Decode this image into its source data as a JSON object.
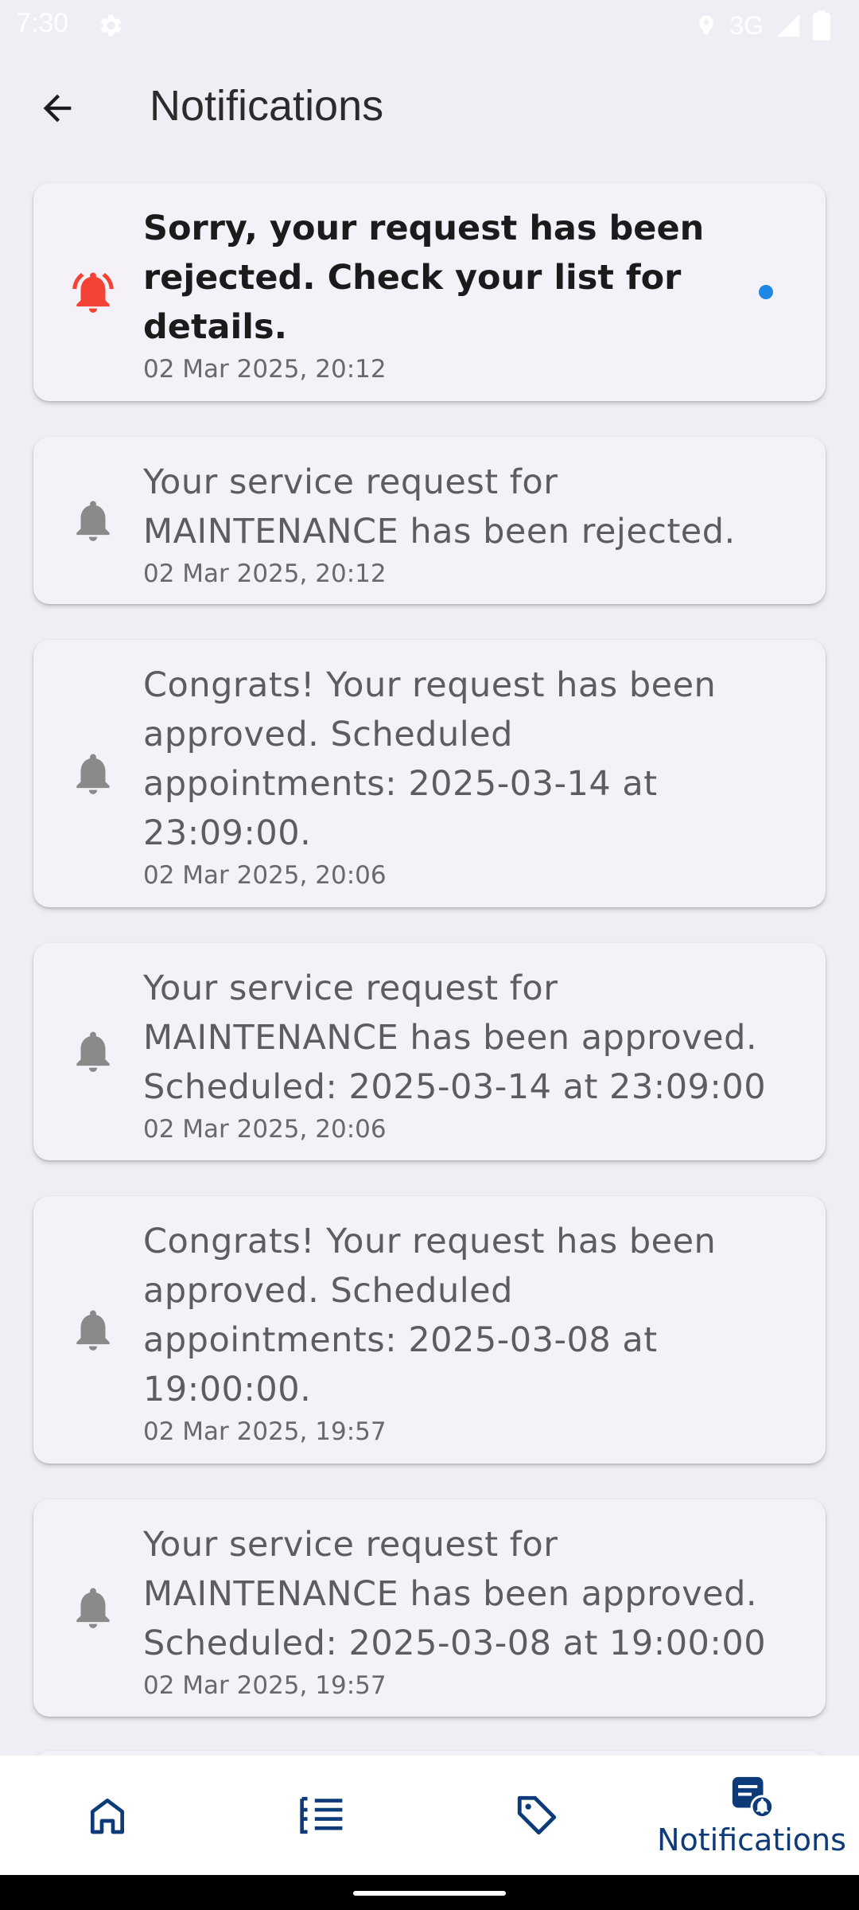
{
  "status_bar": {
    "time": "7:30",
    "network": "3G"
  },
  "header": {
    "title": "Notifications"
  },
  "notifications": [
    {
      "message": "Sorry, your request has been rejected. Check your list for details.",
      "time": "02 Mar 2025, 20:12",
      "unread": true
    },
    {
      "message": "Your service request for MAINTENANCE has been rejected.",
      "time": "02 Mar 2025, 20:12",
      "unread": false
    },
    {
      "message": "Congrats! Your request has been approved. Scheduled appointments: 2025-03-14 at 23:09:00.",
      "time": "02 Mar 2025, 20:06",
      "unread": false
    },
    {
      "message": "Your service request for MAINTENANCE has been approved. Scheduled: 2025-03-14 at 23:09:00",
      "time": "02 Mar 2025, 20:06",
      "unread": false
    },
    {
      "message": "Congrats! Your request has been approved. Scheduled appointments: 2025-03-08 at 19:00:00.",
      "time": "02 Mar 2025, 19:57",
      "unread": false
    },
    {
      "message": "Your service request for MAINTENANCE has been approved. Scheduled: 2025-03-08 at 19:00:00",
      "time": "02 Mar 2025, 19:57",
      "unread": false
    }
  ],
  "bottom_nav": {
    "items": [
      {
        "icon": "home-icon",
        "label": ""
      },
      {
        "icon": "list-icon",
        "label": ""
      },
      {
        "icon": "tag-icon",
        "label": ""
      },
      {
        "icon": "notifications-icon",
        "label": "Notifications",
        "active": true
      }
    ]
  },
  "colors": {
    "unread_bell": "#f44336",
    "read_bell": "#8a8a8a",
    "unread_dot": "#1e88e5",
    "nav_active": "#0d3a78"
  }
}
